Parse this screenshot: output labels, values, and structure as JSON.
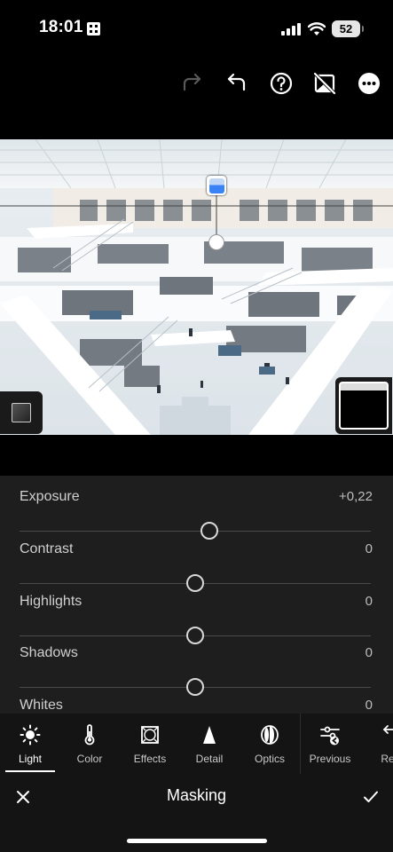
{
  "status_bar": {
    "time": "18:01",
    "battery": "52"
  },
  "toolbar": {
    "redo_icon": "redo-icon",
    "undo_icon": "undo-icon",
    "help_icon": "help-icon",
    "compare_icon": "compare-icon",
    "more_icon": "more-icon"
  },
  "adjustments": [
    {
      "label": "Exposure",
      "value": "+0,22",
      "level": 0.54
    },
    {
      "label": "Contrast",
      "value": "0",
      "level": 0.5
    },
    {
      "label": "Highlights",
      "value": "0",
      "level": 0.5
    },
    {
      "label": "Shadows",
      "value": "0",
      "level": 0.5
    },
    {
      "label": "Whites",
      "value": "0",
      "level": 0.5
    }
  ],
  "tabs": [
    {
      "label": "Light",
      "icon": "sun-icon",
      "active": true
    },
    {
      "label": "Color",
      "icon": "thermometer-icon",
      "active": false
    },
    {
      "label": "Effects",
      "icon": "vignette-icon",
      "active": false
    },
    {
      "label": "Detail",
      "icon": "triangle-icon",
      "active": false
    },
    {
      "label": "Optics",
      "icon": "lens-icon",
      "active": false
    },
    {
      "label": "Previous",
      "icon": "sliders-icon",
      "active": false
    },
    {
      "label": "Res",
      "icon": "reset-icon",
      "active": false
    }
  ],
  "bottom_bar": {
    "title": "Masking"
  },
  "colors": {
    "background": "#000000",
    "panel": "#1e1e1e",
    "tab_bar": "#141414",
    "pin_blue": "#3b82f6"
  }
}
